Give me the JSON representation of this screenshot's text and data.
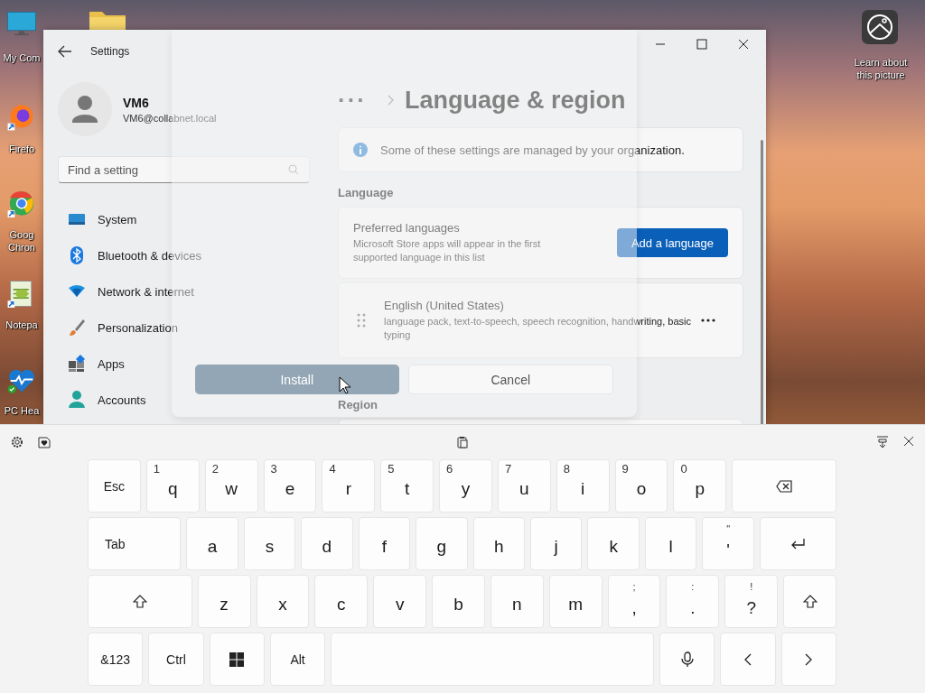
{
  "desktop_icons": [
    {
      "kind": "computer",
      "lines": [
        "My Com"
      ]
    },
    {
      "kind": "folder"
    },
    {
      "kind": "firefox",
      "lines": [
        "Firefo"
      ]
    },
    {
      "kind": "chrome",
      "lines": [
        "Goog",
        "Chron"
      ]
    },
    {
      "kind": "notepad",
      "lines": [
        "Notepa"
      ]
    },
    {
      "kind": "health",
      "lines": [
        "PC Hea"
      ]
    },
    {
      "kind": "picture-info",
      "lines": [
        "Learn about",
        "this picture"
      ]
    }
  ],
  "settings_window": {
    "title": "Settings",
    "account": {
      "name": "VM6",
      "email": "VM6@collabnet.local"
    },
    "search": {
      "placeholder": "Find a setting"
    },
    "nav_items": [
      {
        "kind": "system",
        "label": "System",
        "selected": false
      },
      {
        "kind": "bluetooth",
        "label": "Bluetooth & devices",
        "selected": false
      },
      {
        "kind": "network",
        "label": "Network & internet",
        "selected": false
      },
      {
        "kind": "personalization",
        "label": "Personalization",
        "selected": false
      },
      {
        "kind": "apps",
        "label": "Apps",
        "selected": false
      },
      {
        "kind": "accounts",
        "label": "Accounts",
        "selected": false
      }
    ],
    "breadcrumb": {
      "ellipsis": "···",
      "title": "Language & region"
    },
    "info_banner": "Some of these settings are managed by your organization.",
    "sections": [
      {
        "header": "Language"
      },
      {
        "header": "Region"
      }
    ],
    "preferred_languages": {
      "title": "Preferred languages",
      "description": "Microsoft Store apps will appear in the first supported language in this list",
      "button": "Add a language"
    },
    "languages": [
      {
        "name": "English (United States)",
        "description": "language pack, text-to-speech, speech recognition, handwriting, basic typing"
      }
    ]
  },
  "dialog": {
    "buttons": [
      {
        "label": "Install",
        "kind": "primary",
        "disabled": true
      },
      {
        "label": "Cancel",
        "kind": "secondary",
        "disabled": false
      }
    ]
  },
  "keyboard": {
    "rows": [
      [
        {
          "kind": "text",
          "label": "Esc"
        },
        {
          "kind": "char",
          "label": "q",
          "hint": "1"
        },
        {
          "kind": "char",
          "label": "w",
          "hint": "2"
        },
        {
          "kind": "char",
          "label": "e",
          "hint": "3"
        },
        {
          "kind": "char",
          "label": "r",
          "hint": "4"
        },
        {
          "kind": "char",
          "label": "t",
          "hint": "5"
        },
        {
          "kind": "char",
          "label": "y",
          "hint": "6"
        },
        {
          "kind": "char",
          "label": "u",
          "hint": "7"
        },
        {
          "kind": "char",
          "label": "i",
          "hint": "8"
        },
        {
          "kind": "char",
          "label": "o",
          "hint": "9"
        },
        {
          "kind": "char",
          "label": "p",
          "hint": "0"
        },
        {
          "kind": "backspace"
        }
      ],
      [
        {
          "kind": "tab",
          "label": "Tab"
        },
        {
          "kind": "char",
          "label": "a"
        },
        {
          "kind": "char",
          "label": "s"
        },
        {
          "kind": "char",
          "label": "d"
        },
        {
          "kind": "char",
          "label": "f"
        },
        {
          "kind": "char",
          "label": "g"
        },
        {
          "kind": "char",
          "label": "h"
        },
        {
          "kind": "char",
          "label": "j"
        },
        {
          "kind": "char",
          "label": "k"
        },
        {
          "kind": "char",
          "label": "l"
        },
        {
          "kind": "symbol",
          "label": "'",
          "upper": "\""
        },
        {
          "kind": "enter"
        }
      ],
      [
        {
          "kind": "shift"
        },
        {
          "kind": "char",
          "label": "z"
        },
        {
          "kind": "char",
          "label": "x"
        },
        {
          "kind": "char",
          "label": "c"
        },
        {
          "kind": "char",
          "label": "v"
        },
        {
          "kind": "char",
          "label": "b"
        },
        {
          "kind": "char",
          "label": "n"
        },
        {
          "kind": "char",
          "label": "m"
        },
        {
          "kind": "symbol",
          "label": ",",
          "upper": ";"
        },
        {
          "kind": "symbol",
          "label": ".",
          "upper": ":"
        },
        {
          "kind": "symbol",
          "label": "?",
          "upper": "!"
        },
        {
          "kind": "shift"
        }
      ],
      [
        {
          "kind": "text",
          "label": "&123"
        },
        {
          "kind": "text",
          "label": "Ctrl"
        },
        {
          "kind": "windows"
        },
        {
          "kind": "text",
          "label": "Alt"
        },
        {
          "kind": "space"
        },
        {
          "kind": "microphone"
        },
        {
          "kind": "left"
        },
        {
          "kind": "right"
        }
      ]
    ]
  }
}
